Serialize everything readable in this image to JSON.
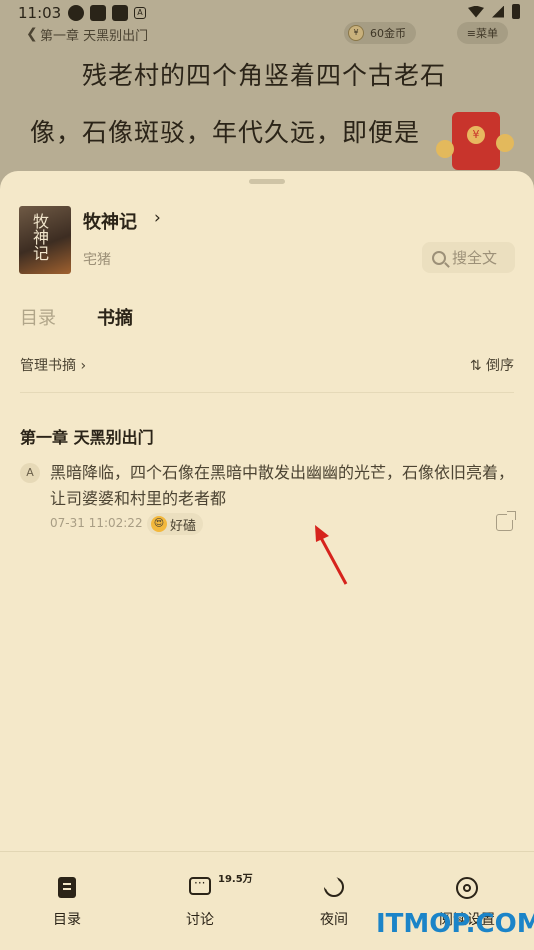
{
  "status_bar": {
    "time": "11:03",
    "icons": [
      "pinwheel-icon",
      "app-icon",
      "app-icon",
      "a-icon"
    ],
    "right_icons": [
      "wifi-icon",
      "signal-icon",
      "battery-icon"
    ]
  },
  "reader": {
    "chapter_link": "第一章 天黑别出门",
    "coins": "60金币",
    "menu": "≡菜单",
    "text_line1": "残老村的四个角竖着四个古老石",
    "text_line2": "像，石像斑驳，年代久远，即便是"
  },
  "book": {
    "title": "牧神记",
    "author": "宅猪",
    "cover_text": "牧神记",
    "search_label": "搜全文"
  },
  "tabs": [
    {
      "label": "目录",
      "active": false
    },
    {
      "label": "书摘",
      "active": true
    }
  ],
  "toolbar": {
    "manage_label": "管理书摘",
    "order_label": "倒序"
  },
  "notes": [
    {
      "chapter": "第一章 天黑别出门",
      "text": "黑暗降临，四个石像在黑暗中散发出幽幽的光芒，石像依旧亮着，让司婆婆和村里的老者都",
      "time": "07-31 11:02:22",
      "reaction": "好磕"
    }
  ],
  "bottom_nav": [
    {
      "label": "目录",
      "icon": "toc-icon"
    },
    {
      "label": "讨论",
      "icon": "chat-icon",
      "badge": "19.5万"
    },
    {
      "label": "夜间",
      "icon": "moon-icon"
    },
    {
      "label": "阅读设置",
      "icon": "settings-icon"
    }
  ],
  "watermark": "ITMOP.COM",
  "colors": {
    "sheet_bg": "#f4e8c9",
    "reader_bg": "#b7ad93",
    "accent_red": "#c8342c",
    "watermark": "#1b84c8"
  }
}
